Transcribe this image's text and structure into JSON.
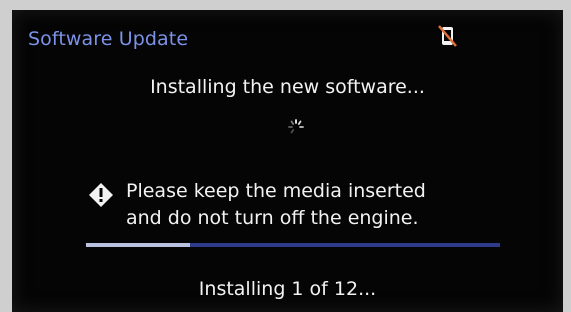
{
  "header": {
    "title": "Software Update",
    "status_icon": "no-phone-icon"
  },
  "main": {
    "status_message": "Installing the new software...",
    "spinner_icon": "loading-spinner-icon",
    "warning_icon": "warning-diamond-icon",
    "warning_line_1": "Please keep the media inserted",
    "warning_line_2": "and do not turn off the engine."
  },
  "progress": {
    "fraction": 0.25,
    "text": "Installing 1 of 12..."
  },
  "colors": {
    "title": "#7b92e6",
    "track": "#2e3b8c",
    "fill": "#b9c1de",
    "background": "#050505"
  }
}
